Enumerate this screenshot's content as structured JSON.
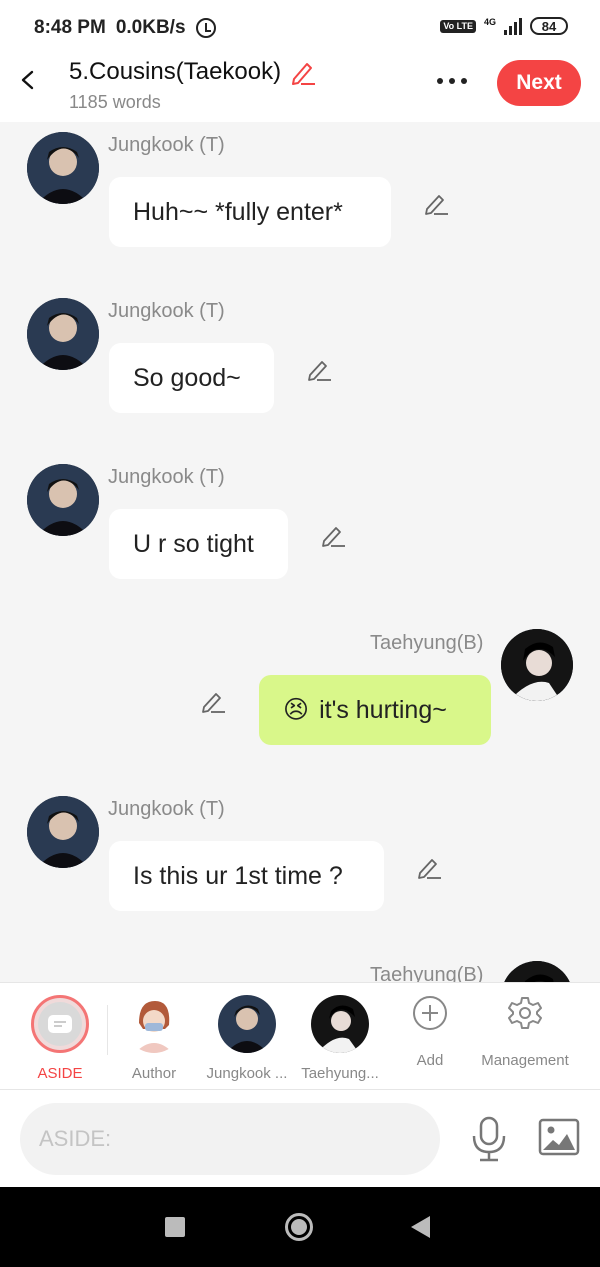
{
  "status_bar": {
    "time": "8:48 PM",
    "net_speed": "0.0KB/s",
    "volte": "Vo LTE",
    "network": "4G",
    "battery": "84"
  },
  "header": {
    "title": "5.Cousins(Taekook)",
    "word_count": "1185 words",
    "next_label": "Next"
  },
  "messages": [
    {
      "sender": "Jungkook (T)",
      "text": "Huh~~ *fully enter*",
      "side": "left"
    },
    {
      "sender": "Jungkook (T)",
      "text": "So good~",
      "side": "left"
    },
    {
      "sender": "Jungkook (T)",
      "text": "U r so tight",
      "side": "left"
    },
    {
      "sender": "Taehyung(B)",
      "emoji": "😣",
      "text": "it's hurting~",
      "side": "right"
    },
    {
      "sender": "Jungkook (T)",
      "text": "Is this ur 1st time ?",
      "side": "left"
    },
    {
      "sender": "Taehyung(B)",
      "text": "",
      "side": "right"
    }
  ],
  "characters": [
    {
      "label": "ASIDE",
      "active": true
    },
    {
      "label": "Author"
    },
    {
      "label": "Jungkook ..."
    },
    {
      "label": "Taehyung..."
    },
    {
      "label": "Add"
    },
    {
      "label": "Management"
    }
  ],
  "input": {
    "placeholder": "ASIDE:"
  },
  "colors": {
    "accent": "#f44444",
    "right_bubble": "#d9f78a",
    "left_bubble": "#ffffff"
  },
  "icons": [
    "back-icon",
    "edit-pen-icon",
    "more-icon",
    "alarm-icon",
    "signal-icon",
    "battery-icon",
    "add-icon",
    "gear-icon",
    "mic-icon",
    "image-icon"
  ]
}
